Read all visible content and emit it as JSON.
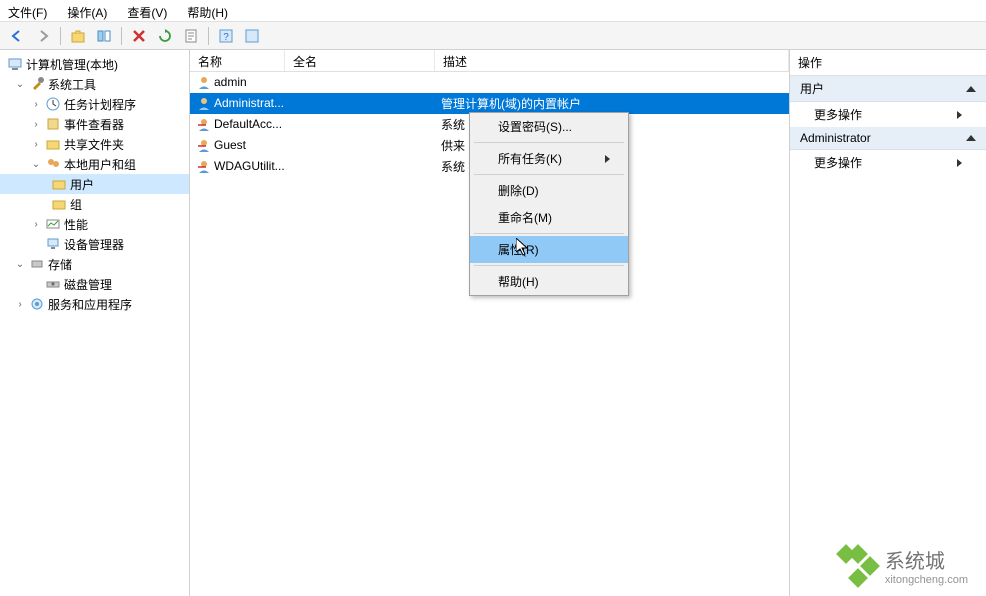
{
  "menu": {
    "file": "文件(F)",
    "action": "操作(A)",
    "view": "查看(V)",
    "help": "帮助(H)"
  },
  "tree": {
    "root": "计算机管理(本地)",
    "system_tools": "系统工具",
    "task_scheduler": "任务计划程序",
    "event_viewer": "事件查看器",
    "shared_folders": "共享文件夹",
    "local_users": "本地用户和组",
    "users": "用户",
    "groups": "组",
    "performance": "性能",
    "device_manager": "设备管理器",
    "storage": "存储",
    "disk_management": "磁盘管理",
    "services": "服务和应用程序"
  },
  "columns": {
    "name": "名称",
    "fullname": "全名",
    "description": "描述"
  },
  "users": [
    {
      "name": "admin",
      "full": "",
      "desc": ""
    },
    {
      "name": "Administrat...",
      "full": "",
      "desc": "管理计算机(域)的内置帐户"
    },
    {
      "name": "DefaultAcc...",
      "full": "",
      "desc": "系统"
    },
    {
      "name": "Guest",
      "full": "",
      "desc": "供来"
    },
    {
      "name": "WDAGUtilit...",
      "full": "",
      "desc": "系统"
    }
  ],
  "context": {
    "set_password": "设置密码(S)...",
    "all_tasks": "所有任务(K)",
    "delete": "删除(D)",
    "rename": "重命名(M)",
    "properties": "属性(R)",
    "help": "帮助(H)"
  },
  "actions": {
    "title": "操作",
    "section1": "用户",
    "more": "更多操作",
    "section2": "Administrator"
  },
  "watermark": {
    "title": "系统城",
    "url": "xitongcheng.com"
  }
}
